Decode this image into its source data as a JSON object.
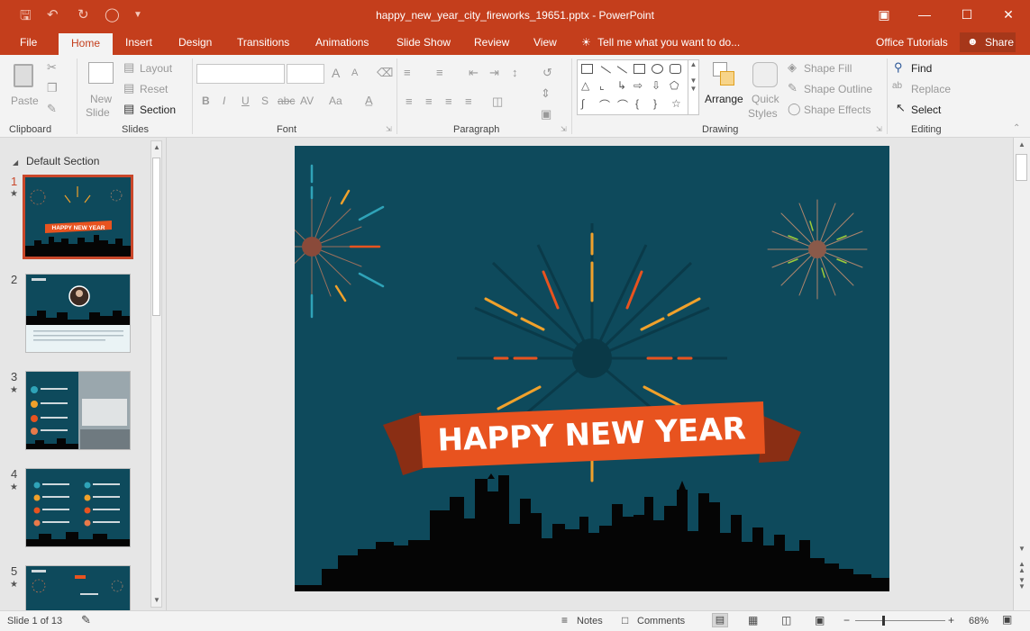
{
  "window": {
    "title": "happy_new_year_city_fireworks_19651.pptx - PowerPoint"
  },
  "tabs": [
    "File",
    "Home",
    "Insert",
    "Design",
    "Transitions",
    "Animations",
    "Slide Show",
    "Review",
    "View"
  ],
  "active_tab": "Home",
  "tell_me": "Tell me what you want to do...",
  "office_tutorials": "Office Tutorials",
  "share": "Share",
  "ribbon": {
    "clipboard": {
      "label": "Clipboard",
      "paste": "Paste"
    },
    "slides": {
      "label": "Slides",
      "new_slide_1": "New",
      "new_slide_2": "Slide",
      "layout": "Layout",
      "reset": "Reset",
      "section": "Section"
    },
    "font": {
      "label": "Font",
      "bold": "B",
      "italic": "I",
      "underline": "U",
      "shadow": "S",
      "strike": "abc",
      "spacing": "AV",
      "case": "Aa",
      "grow": "A",
      "shrink": "A"
    },
    "paragraph": {
      "label": "Paragraph"
    },
    "drawing": {
      "label": "Drawing",
      "arrange": "Arrange",
      "quick_styles_1": "Quick",
      "quick_styles_2": "Styles",
      "shape_fill": "Shape Fill",
      "shape_outline": "Shape Outline",
      "shape_effects": "Shape Effects"
    },
    "editing": {
      "label": "Editing",
      "find": "Find",
      "replace": "Replace",
      "select": "Select"
    }
  },
  "thumbnails": {
    "section": "Default Section",
    "slides": [
      {
        "num": "1",
        "caption": "HAPPY NEW YEAR"
      },
      {
        "num": "2"
      },
      {
        "num": "3"
      },
      {
        "num": "4"
      },
      {
        "num": "5"
      }
    ]
  },
  "slide": {
    "banner_text": "HAPPY NEW YEAR"
  },
  "status": {
    "slide_info": "Slide 1 of 13",
    "notes": "Notes",
    "comments": "Comments",
    "zoom": "68%"
  },
  "colors": {
    "accent": "#c43e1c",
    "slide_bg": "#0e4a5c",
    "banner": "#e8531f",
    "firework_orange": "#f0a12b"
  },
  "icons": [
    "save-icon",
    "undo-icon",
    "redo-icon",
    "present-icon",
    "lightbulb-icon",
    "person-icon",
    "magnifier-icon",
    "cursor-icon"
  ]
}
